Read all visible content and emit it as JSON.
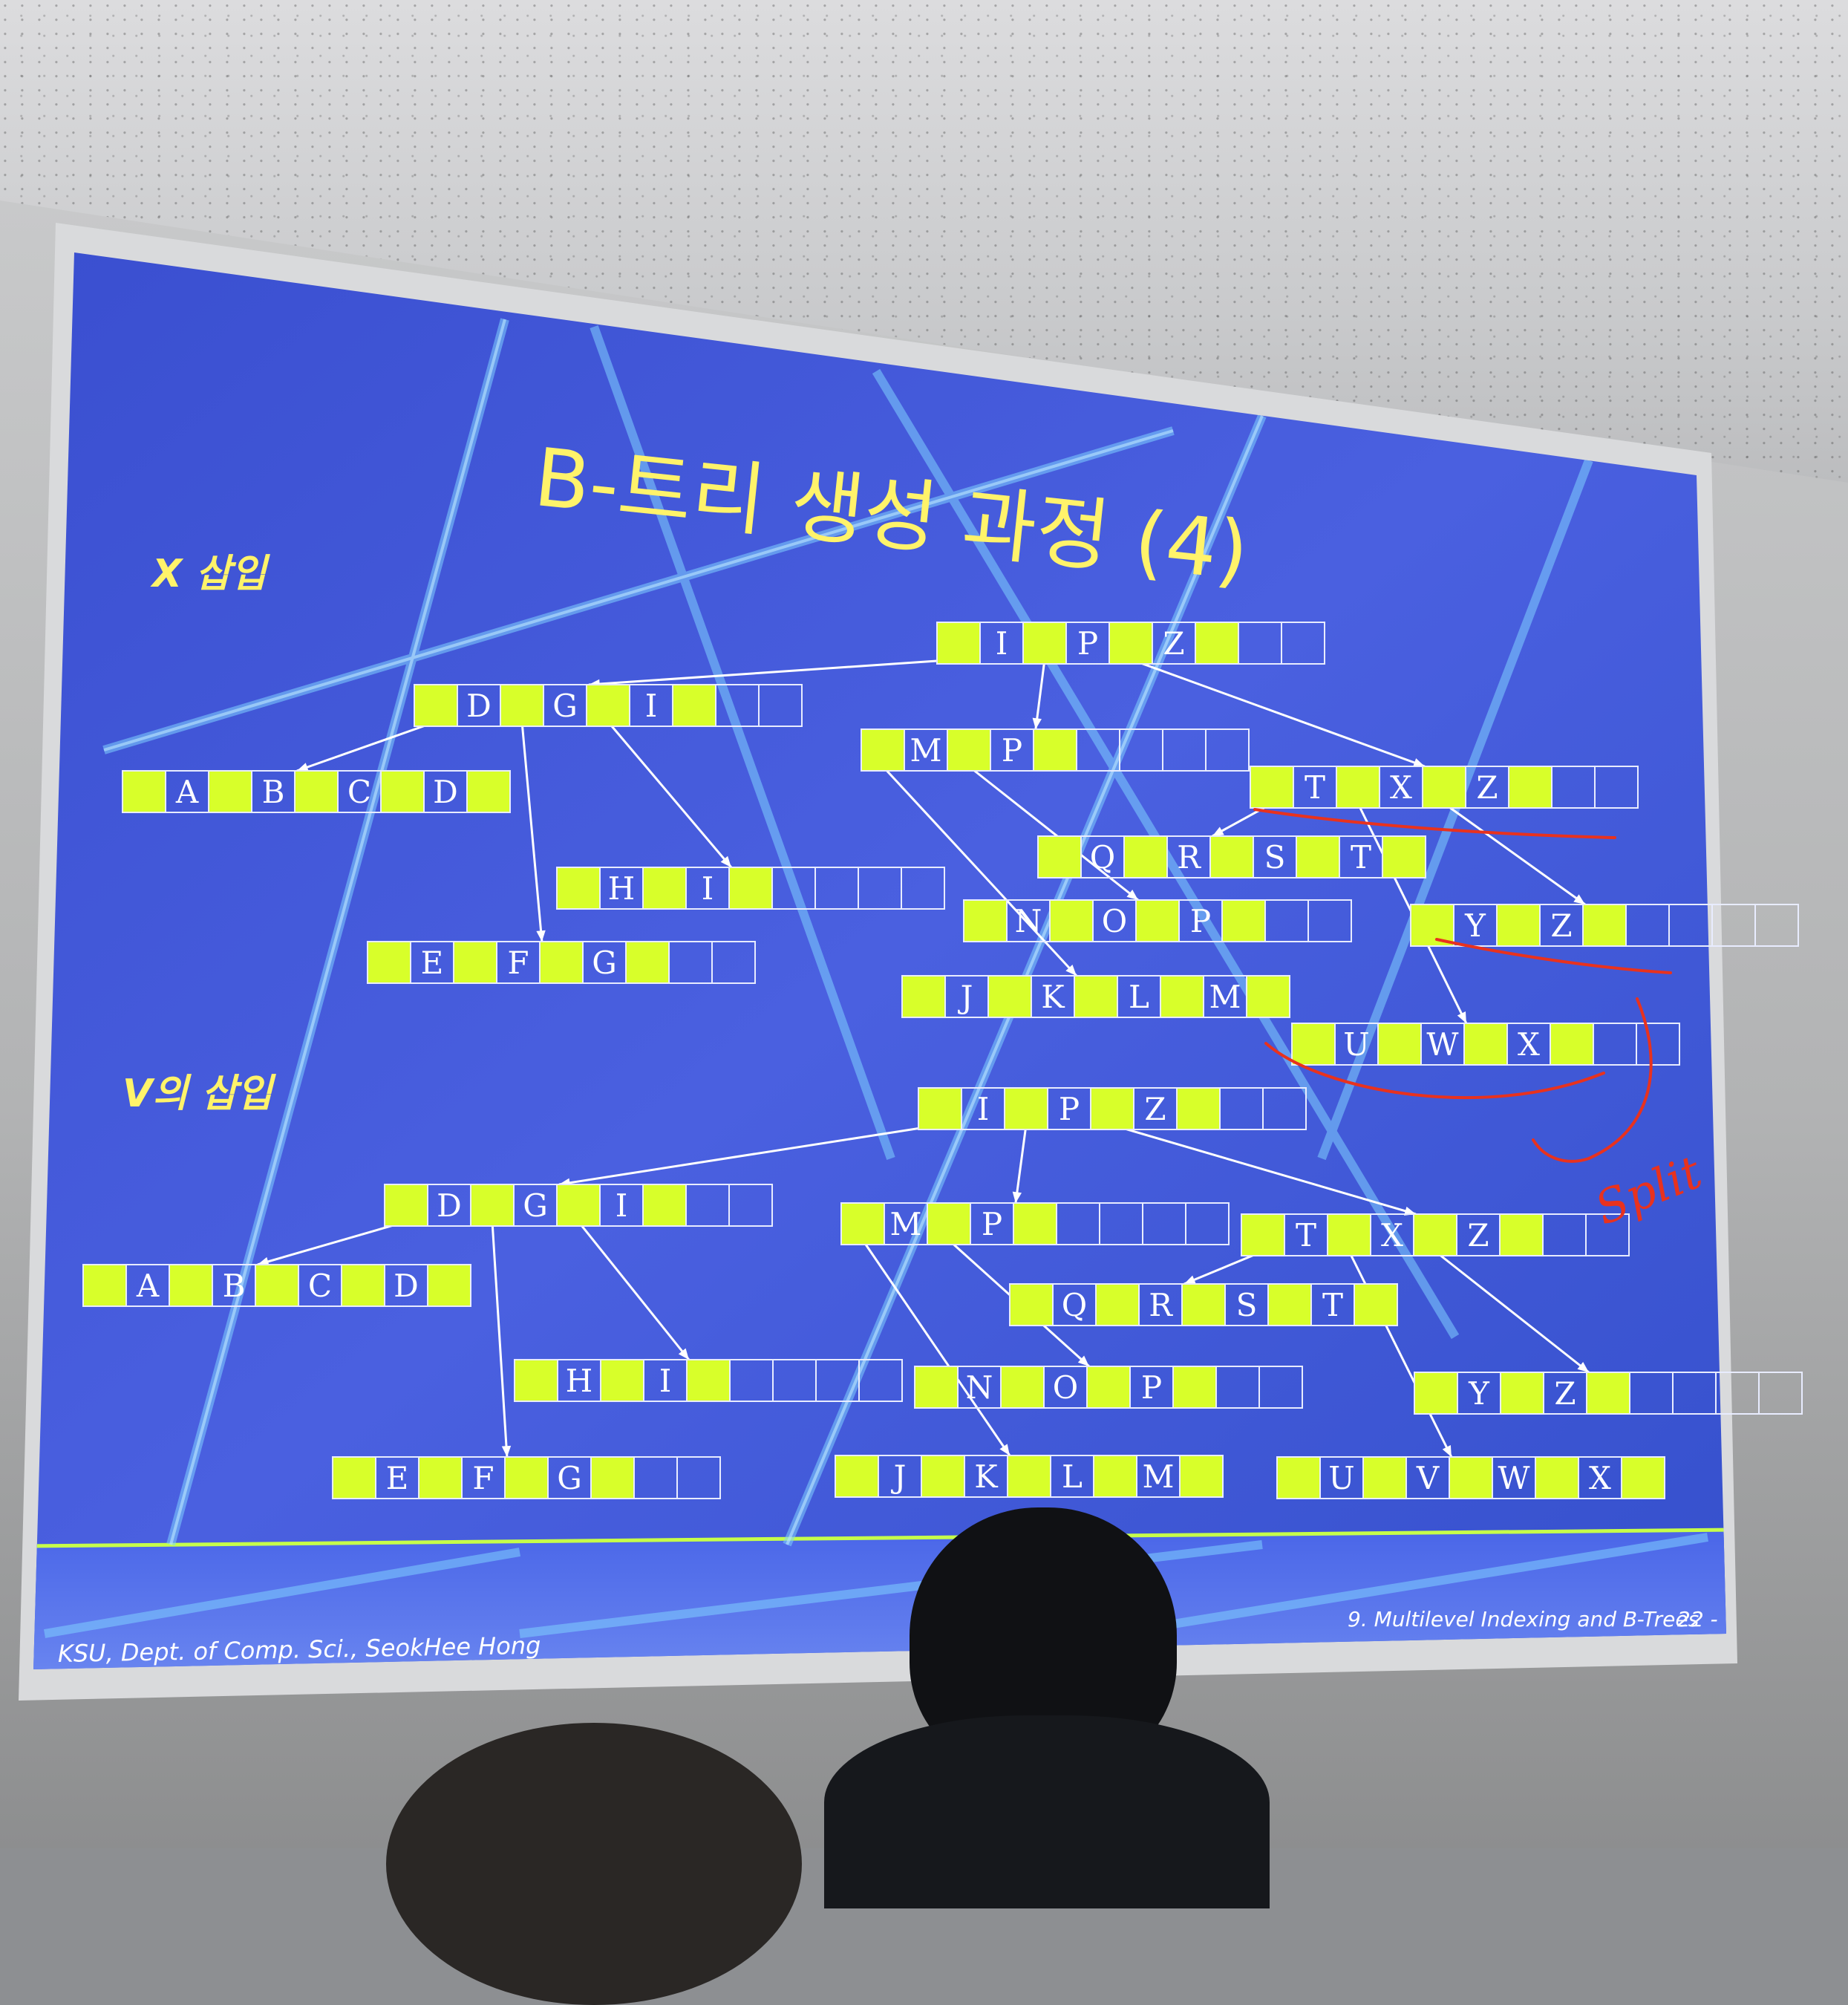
{
  "slide": {
    "title": "B-트리 생성 과정 (4)",
    "section_x": "X 삽입",
    "section_v": "V의 삽입",
    "footer_left": "KSU, Dept. of Comp. Sci., SeokHee Hong",
    "footer_right": "9. Multilevel Indexing and B-Trees",
    "page_number": "- 22 -"
  },
  "handwriting": {
    "note": "Split",
    "color": "#e8321e"
  },
  "colors": {
    "slide_bg": "#3d55d8",
    "pointer_cell": "#d8ff2a",
    "key_text": "#ffffff",
    "title_text": "#fff36a",
    "edge": "#ffffff"
  },
  "tree_x": {
    "nodes": [
      {
        "id": "root",
        "keys": [
          "I",
          "P",
          "Z"
        ]
      },
      {
        "id": "dgi",
        "keys": [
          "D",
          "G",
          "I"
        ]
      },
      {
        "id": "mp",
        "keys": [
          "M",
          "P"
        ]
      },
      {
        "id": "txz",
        "keys": [
          "T",
          "X",
          "Z"
        ]
      },
      {
        "id": "abcd",
        "keys": [
          "A",
          "B",
          "C",
          "D"
        ]
      },
      {
        "id": "hi",
        "keys": [
          "H",
          "I"
        ]
      },
      {
        "id": "efg",
        "keys": [
          "E",
          "F",
          "G"
        ]
      },
      {
        "id": "qrst",
        "keys": [
          "Q",
          "R",
          "S",
          "T"
        ]
      },
      {
        "id": "nop",
        "keys": [
          "N",
          "O",
          "P"
        ]
      },
      {
        "id": "jklm",
        "keys": [
          "J",
          "K",
          "L",
          "M"
        ]
      },
      {
        "id": "yz",
        "keys": [
          "Y",
          "Z"
        ]
      },
      {
        "id": "uwx",
        "keys": [
          "U",
          "W",
          "X"
        ]
      }
    ],
    "edges": [
      [
        "root",
        "dgi"
      ],
      [
        "root",
        "mp"
      ],
      [
        "root",
        "txz"
      ],
      [
        "dgi",
        "abcd"
      ],
      [
        "dgi",
        "efg"
      ],
      [
        "dgi",
        "hi"
      ],
      [
        "mp",
        "jklm"
      ],
      [
        "mp",
        "nop"
      ],
      [
        "txz",
        "qrst"
      ],
      [
        "txz",
        "uwx"
      ],
      [
        "txz",
        "yz"
      ]
    ]
  },
  "tree_v": {
    "nodes": [
      {
        "id": "root",
        "keys": [
          "I",
          "P",
          "Z"
        ]
      },
      {
        "id": "dgi",
        "keys": [
          "D",
          "G",
          "I"
        ]
      },
      {
        "id": "mp",
        "keys": [
          "M",
          "P"
        ]
      },
      {
        "id": "txz",
        "keys": [
          "T",
          "X",
          "Z"
        ]
      },
      {
        "id": "abcd",
        "keys": [
          "A",
          "B",
          "C",
          "D"
        ]
      },
      {
        "id": "hi",
        "keys": [
          "H",
          "I"
        ]
      },
      {
        "id": "efg",
        "keys": [
          "E",
          "F",
          "G"
        ]
      },
      {
        "id": "qrst",
        "keys": [
          "Q",
          "R",
          "S",
          "T"
        ]
      },
      {
        "id": "nop",
        "keys": [
          "N",
          "O",
          "P"
        ]
      },
      {
        "id": "jklm",
        "keys": [
          "J",
          "K",
          "L",
          "M"
        ]
      },
      {
        "id": "yz",
        "keys": [
          "Y",
          "Z"
        ]
      },
      {
        "id": "uvwx",
        "keys": [
          "U",
          "V",
          "W",
          "X"
        ]
      }
    ],
    "edges": [
      [
        "root",
        "dgi"
      ],
      [
        "root",
        "mp"
      ],
      [
        "root",
        "txz"
      ],
      [
        "dgi",
        "abcd"
      ],
      [
        "dgi",
        "efg"
      ],
      [
        "dgi",
        "hi"
      ],
      [
        "mp",
        "jklm"
      ],
      [
        "mp",
        "nop"
      ],
      [
        "txz",
        "qrst"
      ],
      [
        "txz",
        "uvwx"
      ],
      [
        "txz",
        "yz"
      ]
    ]
  }
}
